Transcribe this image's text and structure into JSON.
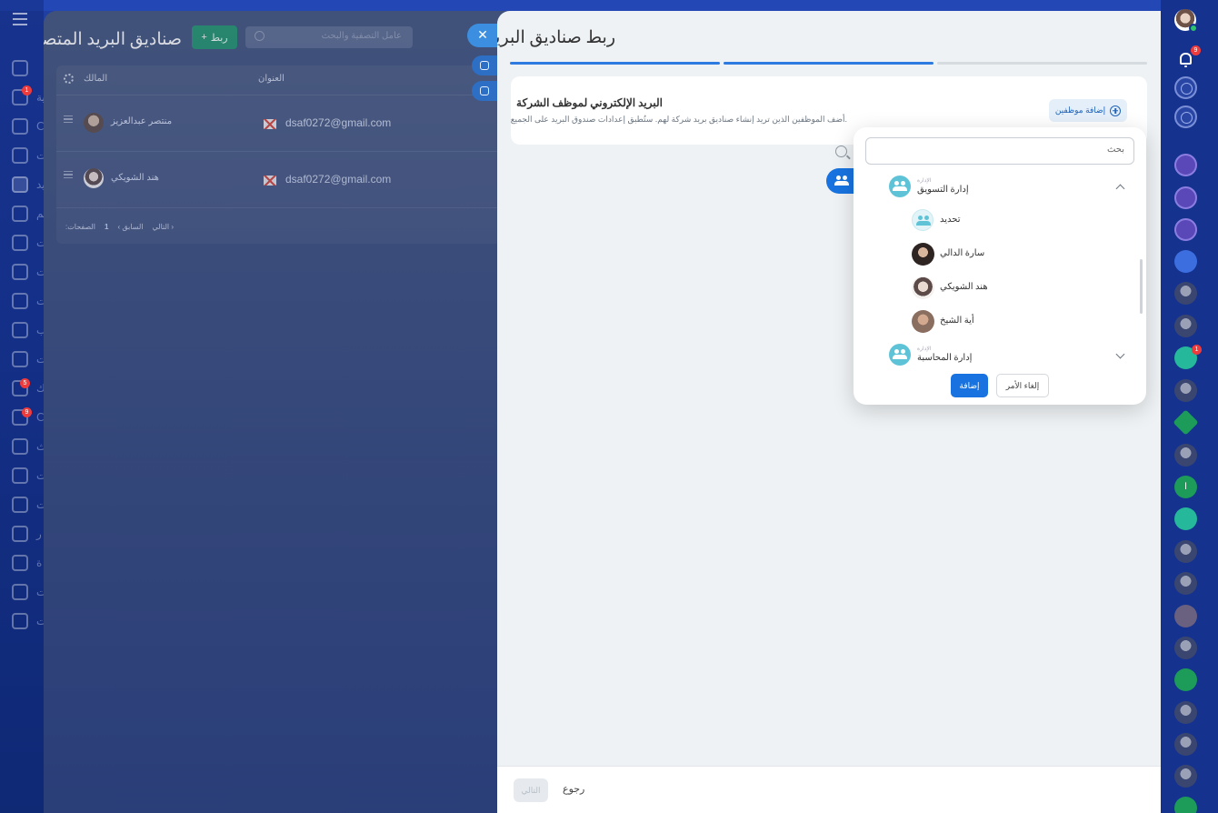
{
  "background": {
    "left_menu_labels": [
      "ية",
      "C",
      "ت",
      "يد",
      "يم",
      "ت",
      "ت",
      "ت",
      "ب",
      "ت",
      "ك",
      "C",
      "ث",
      "ت",
      "ت",
      "ر",
      "ة",
      "ت",
      "ت"
    ],
    "left_menu_badges": [
      "1",
      "5",
      "9"
    ]
  },
  "slider1": {
    "title": "صناديق البريد المتصلة",
    "connect_button": "ربط",
    "search_placeholder": "عامل التصفية والبحث",
    "columns": {
      "owner": "المالك",
      "address": "العنوان"
    },
    "rows": [
      {
        "owner": "منتصر عبدالعزيز",
        "email": "dsaf0272@gmail.com"
      },
      {
        "owner": "هند الشويكي",
        "email": "dsaf0272@gmail.com"
      }
    ],
    "pager": {
      "pages_label": ":الصفحات",
      "page": "1",
      "prev": "السابق",
      "next": "التالي"
    }
  },
  "slider2": {
    "title": "ربط صناديق البريد",
    "card": {
      "title": "البريد الإلكتروني لموظف الشركة",
      "description": ".أضف الموظفين الذين تريد إنشاء صناديق بريد شركة لهم. ستُطبق إعدادات صندوق البريد على الجميع",
      "add_employees_button": "إضافة موظفين"
    },
    "footer": {
      "next_button": "التالي",
      "back_button": "رجوع"
    }
  },
  "popup": {
    "search_placeholder": "بحث",
    "items": [
      {
        "caption": "الإدارة",
        "label": "إدارة التسويق",
        "type": "department",
        "expanded": true
      },
      {
        "label": "تحديد",
        "type": "select-all"
      },
      {
        "label": "سارة الدالي",
        "type": "person"
      },
      {
        "label": "هند الشويكي",
        "type": "person"
      },
      {
        "label": "أية الشيخ",
        "type": "person"
      },
      {
        "caption": "الإدارة",
        "label": "إدارة المحاسبة",
        "type": "department",
        "expanded": false
      }
    ],
    "add_button": "إضافة",
    "cancel_button": "إلغاء الأمر"
  },
  "rightbar": {
    "notification_badge": "9",
    "chat_badge": "1",
    "contact_initials": "ا"
  },
  "colors": {
    "accent": "#1873e0",
    "progress_active": "#2d7be0",
    "connect_green": "#1f8c6b",
    "department_icon": "#5fc3d8"
  }
}
